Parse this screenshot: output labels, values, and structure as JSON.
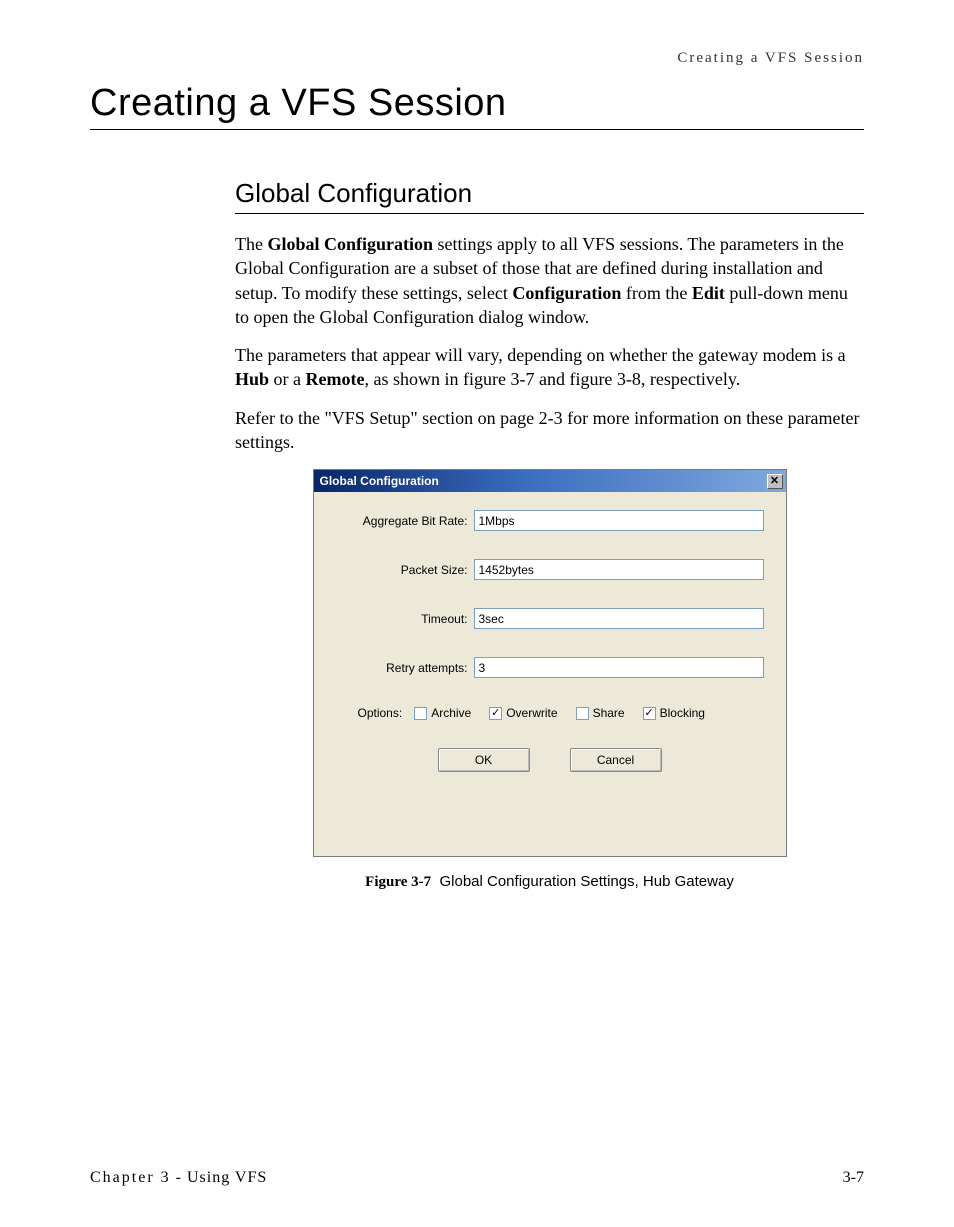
{
  "header": {
    "running": "Creating a VFS Session"
  },
  "title": "Creating a VFS Session",
  "section": {
    "heading": "Global Configuration",
    "para1_pre": "The ",
    "para1_b1": "Global Configuration",
    "para1_mid1": " settings apply to all VFS sessions. The parameters in the Global Configuration are a subset of those that are defined during installation and setup. To modify these settings, select ",
    "para1_b2": "Configuration",
    "para1_mid2": " from the ",
    "para1_b3": "Edit",
    "para1_end": " pull-down menu to open the Global Configuration dialog window.",
    "para2_pre": "The parameters that appear will vary, depending on whether the gateway modem is a ",
    "para2_b1": "Hub",
    "para2_mid1": " or a ",
    "para2_b2": "Remote",
    "para2_end": ", as shown in figure 3-7 and figure 3-8, respectively.",
    "para3": "Refer to the \"VFS Setup\" section on page 2-3 for more information on these parameter settings."
  },
  "dialog": {
    "title": "Global Configuration",
    "fields": {
      "aggregate_label": "Aggregate Bit Rate:",
      "aggregate_value": "1Mbps",
      "packet_label": "Packet Size:",
      "packet_value": "1452bytes",
      "timeout_label": "Timeout:",
      "timeout_value": "3sec",
      "retry_label": "Retry attempts:",
      "retry_value": "3"
    },
    "options": {
      "label": "Options:",
      "archive": {
        "label": "Archive",
        "checked": false
      },
      "overwrite": {
        "label": "Overwrite",
        "checked": true
      },
      "share": {
        "label": "Share",
        "checked": false
      },
      "blocking": {
        "label": "Blocking",
        "checked": true
      }
    },
    "buttons": {
      "ok": "OK",
      "cancel": "Cancel"
    }
  },
  "caption": {
    "label": "Figure 3-7",
    "text": "Global Configuration Settings, Hub Gateway"
  },
  "footer": {
    "chapter_prefix": "Chapter 3",
    "chapter_title": " - Using VFS",
    "page": "3-7"
  }
}
